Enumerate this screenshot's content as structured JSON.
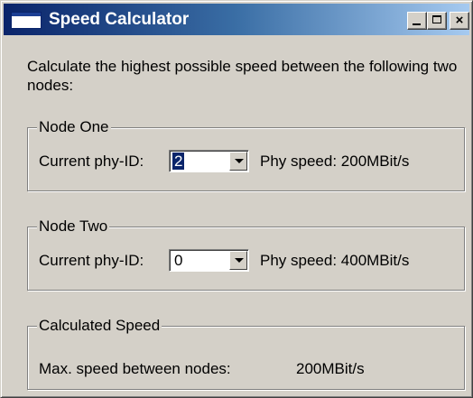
{
  "window": {
    "title": "Speed Calculator",
    "app_icon": "window-icon",
    "controls": {
      "minimize": "minimize-icon",
      "maximize": "maximize-icon",
      "close": "×"
    }
  },
  "intro_text": "Calculate the highest possible speed between the following two nodes:",
  "node_one": {
    "legend": "Node One",
    "phy_id_label": "Current phy-ID:",
    "phy_id_value": "2",
    "speed_text": "Phy speed: 200MBit/s"
  },
  "node_two": {
    "legend": "Node Two",
    "phy_id_label": "Current phy-ID:",
    "phy_id_value": "0",
    "speed_text": "Phy speed: 400MBit/s"
  },
  "calculated": {
    "legend": "Calculated Speed",
    "max_label": "Max. speed between nodes:",
    "max_value": "200MBit/s"
  },
  "colors": {
    "title_bar_start": "#0a246a",
    "title_bar_end": "#a6caf0",
    "dialog_background": "#d4d0c8",
    "selection": "#0a246a"
  }
}
